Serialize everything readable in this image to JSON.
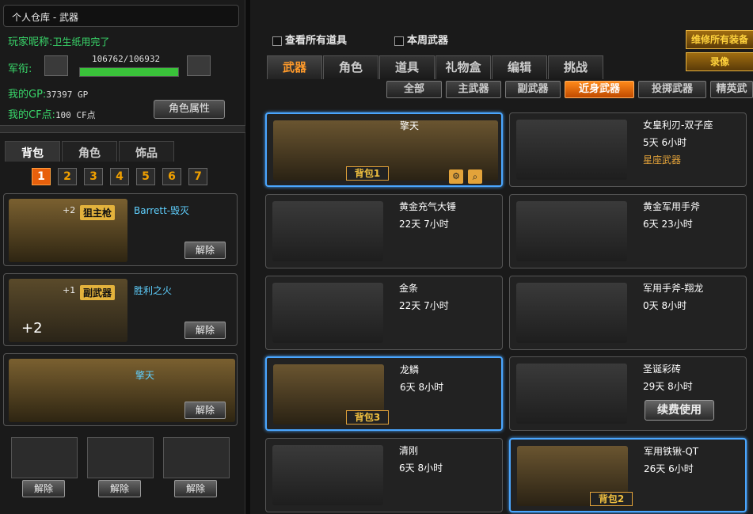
{
  "warehouse_title": "个人仓库 - 武器",
  "player": {
    "nick_label": "玩家昵称:",
    "nick_value": "卫生纸用完了",
    "rank_label": "军衔:",
    "xp_text": "106762/106932",
    "xp_progress": 0.998,
    "gp_label": "我的GP:",
    "gp_value": "37397 GP",
    "cf_label": "我的CF点:",
    "cf_value": "100 CF点",
    "attr_button": "角色属性"
  },
  "left_tabs": [
    "背包",
    "角色",
    "饰品"
  ],
  "left_tab_active": 0,
  "bag_numbers": [
    "1",
    "2",
    "3",
    "4",
    "5",
    "6",
    "7"
  ],
  "bag_active": 0,
  "loadout": [
    {
      "plus": "+2",
      "category": "狙主枪",
      "name": "Barrett-毁灭",
      "button": "解除"
    },
    {
      "plus": "+1",
      "category": "副武器",
      "name": "胜利之火",
      "extra": "+2",
      "button": "解除"
    },
    {
      "name": "擎天",
      "button": "解除"
    }
  ],
  "small_slots": [
    {
      "button": "解除"
    },
    {
      "button": "解除"
    },
    {
      "button": "解除"
    }
  ],
  "top_right": {
    "show_all": "查看所有道具",
    "weekly": "本周武器",
    "btn1": "维修所有装备",
    "btn2": "录像"
  },
  "main_tabs": [
    "武器",
    "角色",
    "道具",
    "礼物盒",
    "编辑",
    "挑战"
  ],
  "main_tab_active": 0,
  "filters": [
    "全部",
    "主武器",
    "副武器",
    "近身武器",
    "投掷武器",
    "精英武"
  ],
  "filter_active": 3,
  "items": [
    {
      "title": "擎天",
      "time": "",
      "bag": "背包1",
      "selected": true
    },
    {
      "title": "女皇利刃-双子座",
      "time": "5天 6小时",
      "tag": "星座武器"
    },
    {
      "title": "黄金充气大锤",
      "time": "22天 7小时"
    },
    {
      "title": "黄金军用手斧",
      "time": "6天 23小时"
    },
    {
      "title": "金条",
      "time": "22天 7小时"
    },
    {
      "title": "军用手斧-翔龙",
      "time": "0天 8小时"
    },
    {
      "title": "龙鳞",
      "time": "6天 8小时",
      "bag": "背包3",
      "selected": true
    },
    {
      "title": "圣诞彩砖",
      "time": "29天 8小时",
      "renew": "续费使用"
    },
    {
      "title": "清刚",
      "time": "6天 8小时"
    },
    {
      "title": "军用铁锹-QT",
      "time": "26天 6小时",
      "bag": "背包2",
      "selected": true
    }
  ],
  "colors": {
    "accent": "#e8600c",
    "select": "#4aa6ff",
    "label_green": "#39d66a",
    "name_cyan": "#5fd0ff"
  }
}
